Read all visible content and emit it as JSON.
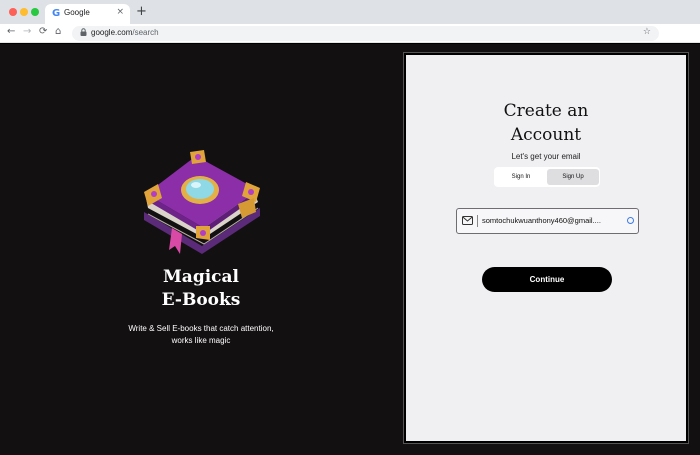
{
  "browser": {
    "tab_favicon": "G",
    "tab_title": "Google",
    "tab_close": "×",
    "new_tab": "+",
    "back": "←",
    "forward": "→",
    "reload": "⟳",
    "home": "⌂",
    "lock": "🔒",
    "url_host": "google.com",
    "url_path": "/search",
    "bookmark": "☆",
    "menu": "⋮"
  },
  "hero": {
    "title_line1": "Magical",
    "title_line2": "E-Books",
    "subtitle_line1": "Write & Sell E-books that catch attention,",
    "subtitle_line2": "works like magic"
  },
  "card": {
    "title_line1": "Create an",
    "title_line2": "Account",
    "subtitle": "Let's get your email",
    "toggle": {
      "sign_in": "Sign In",
      "sign_up": "Sign Up",
      "selected": "Sign Up"
    },
    "email_value": "somtochukwuanthony460@gmail....",
    "continue_label": "Continue"
  },
  "icons": [
    "google-icon",
    "lock-icon",
    "star-icon",
    "mail-icon",
    "book-illustration"
  ]
}
